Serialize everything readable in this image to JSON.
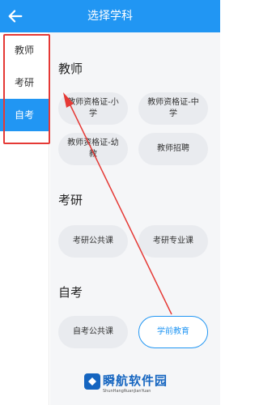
{
  "header": {
    "title": "选择学科",
    "back_icon": "arrow-left-icon"
  },
  "sidebar": {
    "items": [
      {
        "label": "教师",
        "active": false
      },
      {
        "label": "考研",
        "active": false
      },
      {
        "label": "自考",
        "active": true
      }
    ]
  },
  "sections": [
    {
      "title": "教师",
      "chips": [
        {
          "label": "教师资格证-小学"
        },
        {
          "label": "教师资格证-中学"
        },
        {
          "label": "教师资格证-幼教"
        },
        {
          "label": "教师招聘"
        }
      ]
    },
    {
      "title": "考研",
      "chips": [
        {
          "label": "考研公共课"
        },
        {
          "label": "考研专业课"
        }
      ]
    },
    {
      "title": "自考",
      "chips": [
        {
          "label": "自考公共课"
        },
        {
          "label": "学前教育",
          "selected": true
        }
      ]
    }
  ],
  "watermark": {
    "name": "瞬航软件园",
    "url": "ShunHangRuanJianYuan"
  },
  "colors": {
    "accent": "#2196f3",
    "annotation": "#e53935"
  }
}
